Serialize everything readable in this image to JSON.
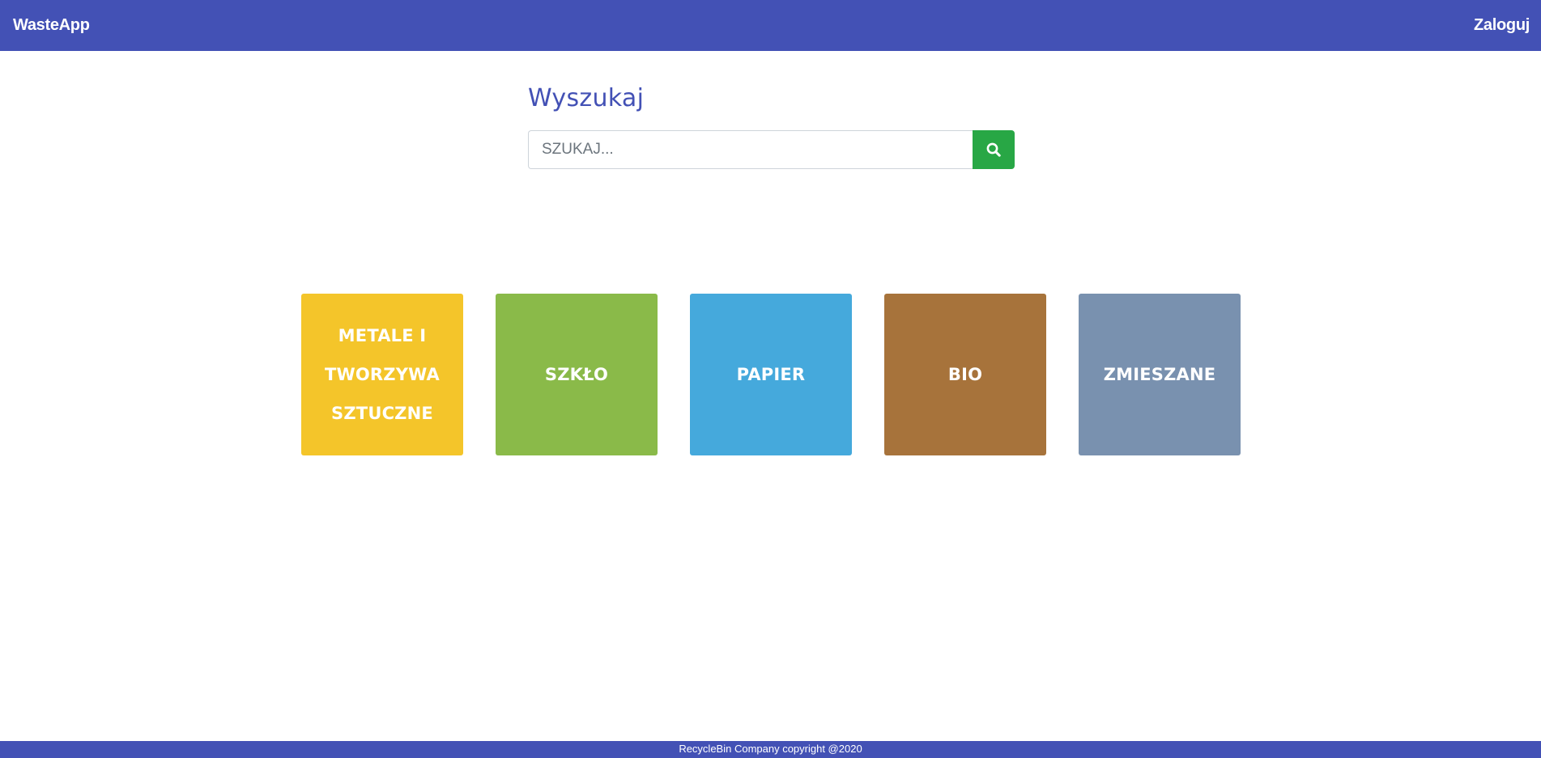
{
  "navbar": {
    "brand": "WasteApp",
    "login_label": "Zaloguj",
    "color": "#4351b5"
  },
  "search": {
    "title": "Wyszukaj",
    "placeholder": "SZUKAJ...",
    "value": "",
    "button_icon": "search-icon",
    "button_color": "#28a745"
  },
  "categories": [
    {
      "label": "METALE I TWORZYWA SZTUCZNE",
      "color": "#f4c52a"
    },
    {
      "label": "SZKŁO",
      "color": "#8aba49"
    },
    {
      "label": "PAPIER",
      "color": "#45a9dc"
    },
    {
      "label": "BIO",
      "color": "#a7733b"
    },
    {
      "label": "ZMIESZANE",
      "color": "#7991af"
    }
  ],
  "footer": {
    "text": "RecycleBin Company copyright @2020"
  }
}
